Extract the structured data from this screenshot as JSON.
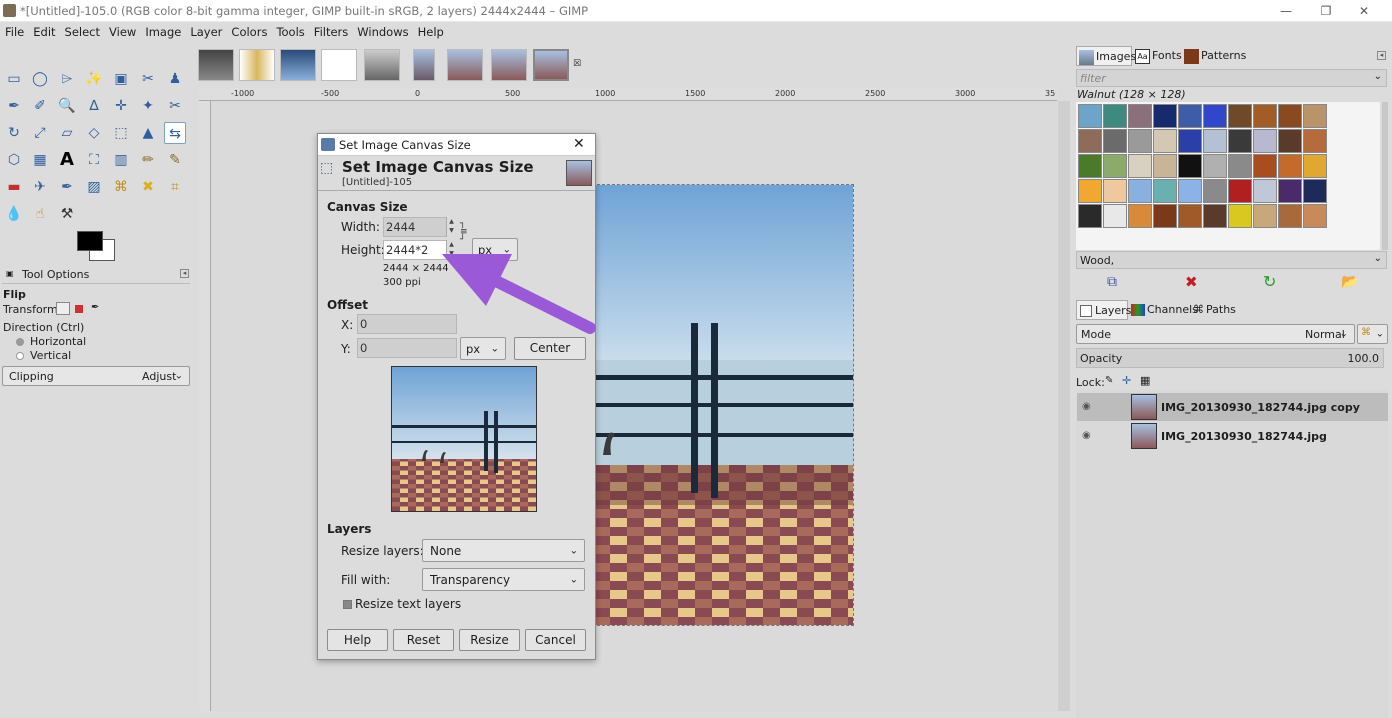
{
  "window": {
    "title": "*[Untitled]-105.0 (RGB color 8-bit gamma integer, GIMP built-in sRGB, 2 layers) 2444x2444 – GIMP"
  },
  "menu": [
    "File",
    "Edit",
    "Select",
    "View",
    "Image",
    "Layer",
    "Colors",
    "Tools",
    "Filters",
    "Windows",
    "Help"
  ],
  "ruler": {
    "labels": [
      "-1000",
      "-500",
      "0",
      "500",
      "1000",
      "1500",
      "2000",
      "2500",
      "3000",
      "35"
    ]
  },
  "tool_options": {
    "tab": "Tool Options",
    "tool_name": "Flip",
    "transform_label": "Transform:",
    "direction_label": "Direction  (Ctrl)",
    "horizontal": "Horizontal",
    "vertical": "Vertical",
    "clipping_label": "Clipping",
    "clipping_value": "Adjust"
  },
  "dialog": {
    "window_title": "Set Image Canvas Size",
    "header_title": "Set Image Canvas Size",
    "header_sub": "[Untitled]-105",
    "canvas_size_label": "Canvas Size",
    "width_label": "Width:",
    "width_value": "2444",
    "height_label": "Height:",
    "height_value": "2444*2",
    "unit": "px",
    "dims_info": "2444 × 2444",
    "ppi_info": "300 ppi",
    "offset_label": "Offset",
    "x_label": "X:",
    "x_value": "0",
    "y_label": "Y:",
    "y_value": "0",
    "offset_unit": "px",
    "center_btn": "Center",
    "layers_label": "Layers",
    "resize_layers_label": "Resize layers:",
    "resize_layers_value": "None",
    "fill_with_label": "Fill with:",
    "fill_with_value": "Transparency",
    "resize_text_label": "Resize text layers",
    "buttons": {
      "help": "Help",
      "reset": "Reset",
      "resize": "Resize",
      "cancel": "Cancel"
    }
  },
  "right_dock": {
    "tabs": {
      "images": "Images",
      "fonts": "Fonts",
      "patterns": "Patterns"
    },
    "filter_placeholder": "filter",
    "pattern_name": "Walnut (128 × 128)",
    "pattern_tag": "Wood,",
    "layer_tabs": {
      "layers": "Layers",
      "channels": "Channels",
      "paths": "Paths"
    },
    "mode_label": "Mode",
    "mode_value": "Normal",
    "opacity_label": "Opacity",
    "opacity_value": "100.0",
    "lock_label": "Lock:",
    "layers": [
      {
        "name": "IMG_20130930_182744.jpg copy",
        "selected": true
      },
      {
        "name": "IMG_20130930_182744.jpg",
        "selected": false
      }
    ]
  },
  "pattern_colors": [
    "#6fa4c9",
    "#3f8a7e",
    "#8b6f7a",
    "#162a6e",
    "#3f5ca8",
    "#2f47c8",
    "#6e4a2a",
    "#a35c26",
    "#8a4a1f",
    "#b9946a",
    "#8d6c5a",
    "#6b6b6b",
    "#9a9a9a",
    "#d4c7b3",
    "#2a3fa8",
    "#b4c0d4",
    "#3a3a3a",
    "#b8b8d0",
    "#5a3a2a",
    "#b56c3a",
    "#4b7a2a",
    "#8cab6b",
    "#d8d0c0",
    "#c8b496",
    "#111111",
    "#b0b0b0",
    "#8a8a8a",
    "#a84e1e",
    "#c46a2a",
    "#e0a830",
    "#f0a830",
    "#f0c8a0",
    "#8ab0e0",
    "#6ab0b0",
    "#8ab4e8",
    "#8a8a8a",
    "#b02020",
    "#c0c8d8",
    "#4a2a6a",
    "#1e2a5a",
    "#2a2a2a",
    "#e8e8e8",
    "#d88a3a",
    "#7a3a1a",
    "#a05a2a",
    "#5a3a2a",
    "#d8c820",
    "#c8a878",
    "#a86a3a",
    "#c88a5a"
  ],
  "colors": {
    "accent": "#9a5ad8",
    "selection": "#bcbcbc"
  }
}
